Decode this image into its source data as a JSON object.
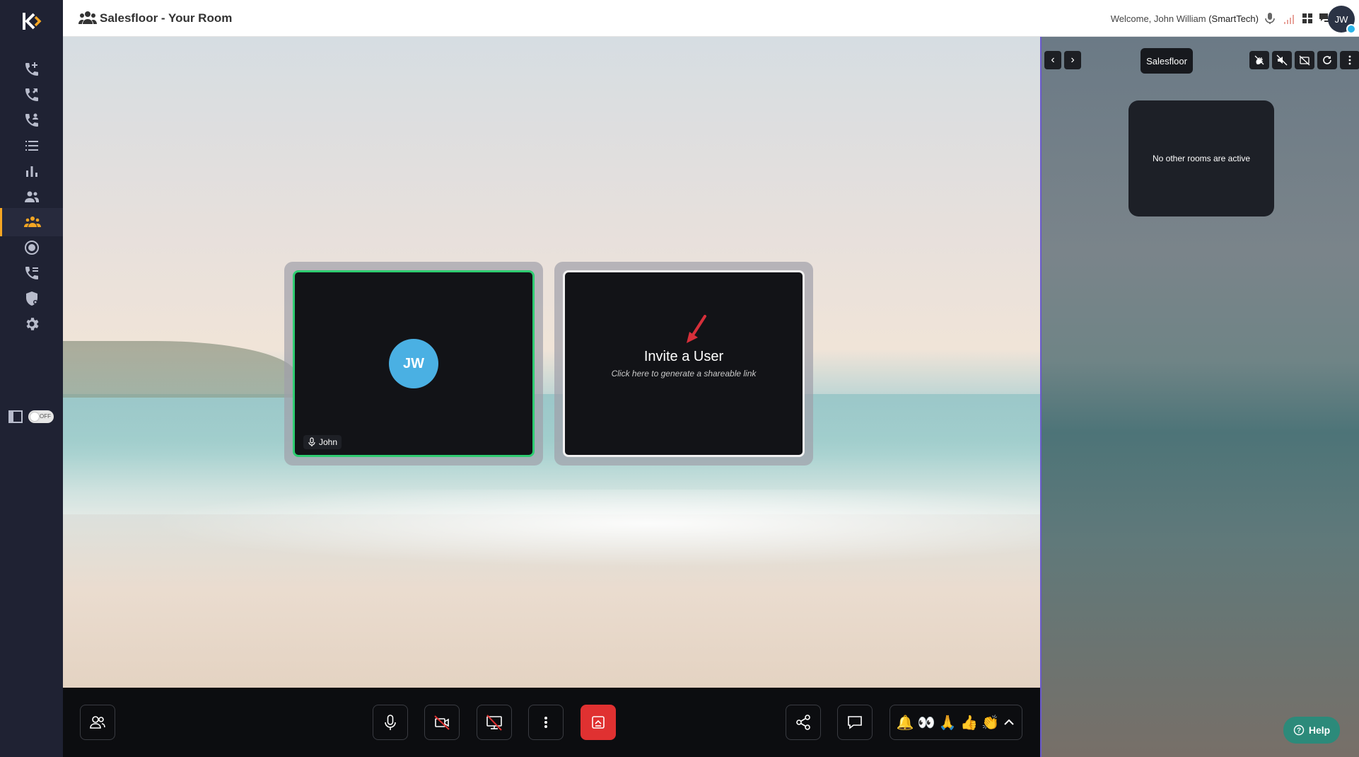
{
  "header": {
    "title": "Salesfloor - Your Room",
    "welcome_prefix": "Welcome, John William ",
    "welcome_org": "(SmartTech)",
    "avatar_initials": "JW"
  },
  "sidebar": {
    "toggle_label": "OFF",
    "items": [
      {
        "icon": "phone-add-icon"
      },
      {
        "icon": "phone-transfer-icon"
      },
      {
        "icon": "phone-group-icon"
      },
      {
        "icon": "list-icon"
      },
      {
        "icon": "bar-chart-icon"
      },
      {
        "icon": "users-icon"
      },
      {
        "icon": "team-icon",
        "active": true
      },
      {
        "icon": "record-icon"
      },
      {
        "icon": "phone-forward-icon"
      },
      {
        "icon": "shield-icon"
      },
      {
        "icon": "gear-icon"
      }
    ]
  },
  "stage": {
    "participant_initials": "JW",
    "participant_name": "John",
    "invite_title": "Invite a User",
    "invite_subtitle": "Click here to generate a shareable link"
  },
  "right_panel": {
    "title": "Salesfloor",
    "empty_message": "No other rooms are active",
    "help_label": "Help"
  },
  "reactions": [
    "🔔",
    "👀",
    "🙏",
    "👍",
    "👏"
  ],
  "colors": {
    "sidebar_bg": "#1f2233",
    "accent": "#f5a623",
    "active_speaker_border": "#2ecc71",
    "avatar_bg": "#4ab0e3",
    "leave_button": "#e03131"
  }
}
